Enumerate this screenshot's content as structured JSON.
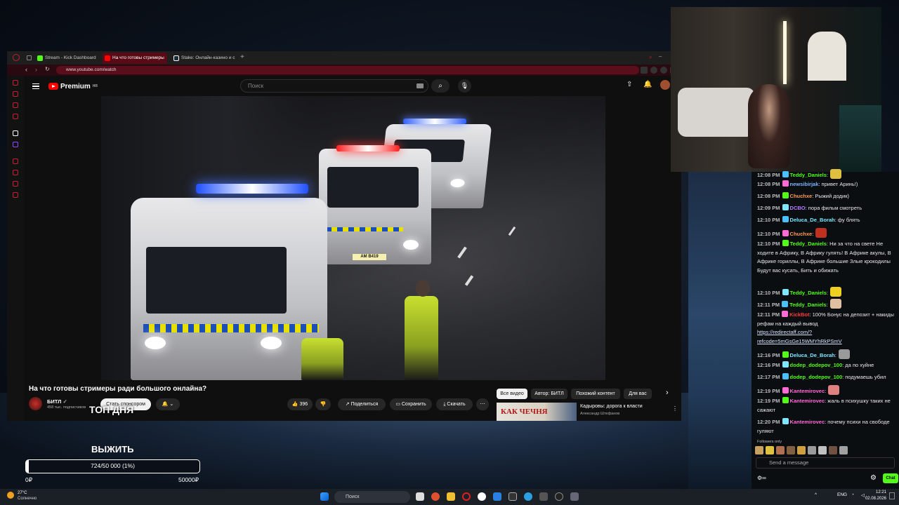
{
  "browser": {
    "tabs": [
      {
        "label": "Stream - Kick Dashboard",
        "color": "#53fc18"
      },
      {
        "label": "На что готовы стримеры",
        "color": "#ff0000"
      },
      {
        "label": "Stake: Онлайн-казино и с",
        "color": "#1a2c38"
      }
    ],
    "url": "www.youtube.com/watch"
  },
  "youtube": {
    "logo": "Premium",
    "logo_sup": "HR",
    "search_placeholder": "Поиск",
    "video_title": "На что готовы стримеры ради большого онлайна?",
    "channel": "БИТЛ",
    "subscribers": "458 тыс. подписчиков",
    "sponsor_label": "Стать спонсором",
    "likes": "396",
    "share": "Поделиться",
    "save": "Сохранить",
    "download": "Скачать",
    "chips": [
      "Все видео",
      "Автор: БИТЛ",
      "Похожий контент",
      "Для вас"
    ],
    "reco": {
      "thumb_text": "КАК ЧЕЧНЯ",
      "title": "Кадыровы: дорога к власти",
      "author": "Александр Штефанов"
    }
  },
  "overlay": {
    "top_day": "ТОП ДНЯ",
    "goal_title": "ВЫЖИТЬ",
    "goal_text": "724/50 000 (1%)",
    "goal_progress": 0.0145,
    "goal_min": "0₽",
    "goal_max": "50000₽"
  },
  "chat": {
    "messages": [
      {
        "time": "12:08 PM",
        "user": "Teddy_Daniels",
        "ucolor": "#53fc18",
        "text": ":"
      },
      {
        "time": "12:08 PM",
        "user": "newsibirjak",
        "ucolor": "#7db4ff",
        "text": ": привет Аринь!)"
      },
      {
        "time": "12:08 PM",
        "user": "Chuchxe",
        "ucolor": "#ff9a55",
        "text": ": Рыжий додик)"
      },
      {
        "time": "12:09 PM",
        "user": "DCBO",
        "ucolor": "#b77dff",
        "text": ": пора фильм смотреть"
      },
      {
        "time": "12:10 PM",
        "user": "Deluca_De_Borah",
        "ucolor": "#7de8ff",
        "text": ": фу блять"
      },
      {
        "time": "12:10 PM",
        "user": "Chuchxe",
        "ucolor": "#ff9a55",
        "text": ":"
      },
      {
        "time": "12:10 PM",
        "user": "Teddy_Daniels",
        "ucolor": "#53fc18",
        "text": ": Ни за что на свете Не ходите в Африку, В Африку гулять! В Африке акулы, В Африке гориллы, В Африке большие Злые крокодилы Будут вас кусать, Бить и обижать"
      },
      {
        "time": "12:10 PM",
        "user": "Teddy_Daniels",
        "ucolor": "#53fc18",
        "text": ":"
      },
      {
        "time": "12:11 PM",
        "user": "Teddy_Daniels",
        "ucolor": "#53fc18",
        "text": ":"
      },
      {
        "time": "12:11 PM",
        "user": "KickBot",
        "ucolor": "#ff3b3b",
        "text": ": 100% Бонус на депозит + накиды рефам на каждый вывод",
        "link": "https://redirectaff.com/?refcode=5mGsGe15WMYhRkPSmV"
      },
      {
        "time": "12:16 PM",
        "user": "Deluca_De_Borah",
        "ucolor": "#7de8ff",
        "text": ":"
      },
      {
        "time": "12:16 PM",
        "user": "dodep_dodepov_100",
        "ucolor": "#53fc18",
        "text": ": да по хуйне"
      },
      {
        "time": "12:17 PM",
        "user": "dodep_dodepov_100",
        "ucolor": "#53fc18",
        "text": ": подумаешь убил"
      },
      {
        "time": "12:19 PM",
        "user": "Kantemirovec",
        "ucolor": "#ff6ad5",
        "text": ":"
      },
      {
        "time": "12:19 PM",
        "user": "Kantemirovec",
        "ucolor": "#ff6ad5",
        "text": ": жаль в психушку таких не сажают"
      },
      {
        "time": "12:20 PM",
        "user": "Kantemirovec",
        "ucolor": "#ff6ad5",
        "text": ": почему психи на свободе гуляют"
      }
    ],
    "followers_only": "Followers only",
    "placeholder": "Send a message",
    "chat_button": "Chat"
  },
  "taskbar": {
    "temp": "27°C",
    "weather": "Солнечно",
    "search": "Поиск",
    "lang": "ENG",
    "time": "12:21",
    "date": "02.08.2026"
  }
}
